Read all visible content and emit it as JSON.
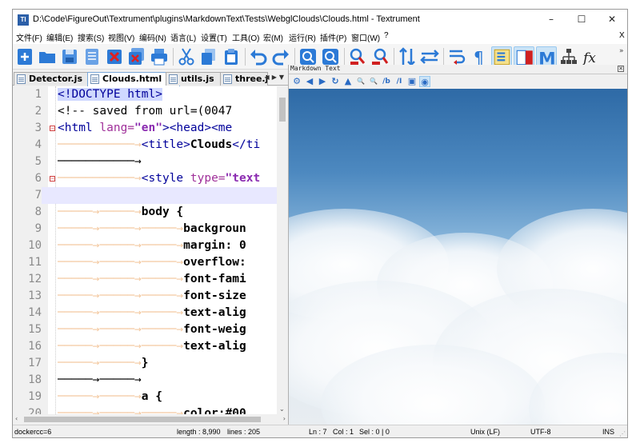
{
  "window": {
    "title": "D:\\Code\\FigureOut\\Textrument\\plugins\\MarkdownText\\Tests\\WebglClouds\\Clouds.html - Textrument",
    "app_icon_text": "TI",
    "controls": {
      "minimize": "–",
      "maximize": "☐",
      "close": "✕"
    }
  },
  "menu": {
    "items": [
      "文件(F)",
      "编辑(E)",
      "搜索(S)",
      "视图(V)",
      "编码(N)",
      "语言(L)",
      "设置(T)",
      "工具(O)",
      "宏(M)",
      "运行(R)",
      "插件(P)",
      "窗口(W)",
      "?"
    ],
    "close_label": "X"
  },
  "toolbar": {
    "buttons": [
      {
        "name": "new-file",
        "icon": "new-file-icon"
      },
      {
        "name": "open-folder",
        "icon": "folder-icon"
      },
      {
        "name": "save",
        "icon": "save-icon"
      },
      {
        "name": "save-all",
        "icon": "save-all-icon"
      },
      {
        "name": "close",
        "icon": "close-file-icon"
      },
      {
        "name": "close-all",
        "icon": "close-all-icon"
      },
      {
        "name": "print",
        "icon": "print-icon"
      },
      {
        "name": "cut",
        "icon": "cut-icon"
      },
      {
        "name": "copy",
        "icon": "copy-icon"
      },
      {
        "name": "paste",
        "icon": "paste-icon"
      },
      {
        "name": "undo",
        "icon": "undo-icon"
      },
      {
        "name": "redo",
        "icon": "redo-icon"
      },
      {
        "name": "zoom-in",
        "icon": "zoom-in-icon"
      },
      {
        "name": "zoom-out",
        "icon": "zoom-out-icon"
      },
      {
        "name": "find",
        "icon": "find-icon"
      },
      {
        "name": "replace",
        "icon": "replace-icon"
      },
      {
        "name": "sync-vertical",
        "icon": "sync-vertical-icon"
      },
      {
        "name": "sync-horizontal",
        "icon": "sync-horizontal-icon"
      },
      {
        "name": "word-wrap",
        "icon": "word-wrap-icon"
      },
      {
        "name": "show-all-chars",
        "icon": "pilcrow-icon"
      },
      {
        "name": "indent-guide",
        "icon": "indent-guide-icon"
      },
      {
        "name": "document-map",
        "icon": "document-map-icon"
      },
      {
        "name": "markdown-text",
        "icon": "markdown-icon"
      },
      {
        "name": "function-list",
        "icon": "function-list-icon"
      },
      {
        "name": "fx",
        "icon": "fx-icon"
      }
    ],
    "overflow_label": "»"
  },
  "tabs": [
    {
      "label": "Detector.js",
      "active": false
    },
    {
      "label": "Clouds.html",
      "active": true
    },
    {
      "label": "utils.js",
      "active": false
    },
    {
      "label": "three.js",
      "active": false
    }
  ],
  "tab_nav": {
    "prev": "◀",
    "next": "▶",
    "close": "▼"
  },
  "editor": {
    "current_line": 7,
    "lines": [
      {
        "n": "1"
      },
      {
        "n": "2"
      },
      {
        "n": "3"
      },
      {
        "n": "4"
      },
      {
        "n": "5"
      },
      {
        "n": "6"
      },
      {
        "n": "7"
      },
      {
        "n": "8"
      },
      {
        "n": "9"
      },
      {
        "n": "10"
      },
      {
        "n": "11"
      },
      {
        "n": "12"
      },
      {
        "n": "13"
      },
      {
        "n": "14"
      },
      {
        "n": "15"
      },
      {
        "n": "16"
      },
      {
        "n": "17"
      },
      {
        "n": "18"
      },
      {
        "n": "19"
      },
      {
        "n": "20"
      }
    ],
    "code": {
      "l1": "<!DOCTYPE html>",
      "l2": "<!-- saved from url=(0047",
      "l3a": "<html ",
      "l3b": "lang=",
      "l3c": "\"en\"",
      "l3d": "><head><me",
      "l4a": "<title>",
      "l4b": "Clouds",
      "l4c": "</ti",
      "l6a": "<style ",
      "l6b": "type=",
      "l6c": "\"text",
      "l8": "body {",
      "l9": "backgroun",
      "l10": "margin: 0",
      "l11": "overflow:",
      "l12": "font-fami",
      "l13": "font-size",
      "l14": "text-alig",
      "l15": "font-weig",
      "l16": "text-alig",
      "l17": "}",
      "l19": "a {",
      "l20": "color:#00"
    }
  },
  "markdown_panel": {
    "title": "Markdown Text",
    "close": "✕",
    "tools": [
      "⚙",
      "◀",
      "▶",
      "↻",
      "▲",
      "🔍+",
      "🔍−",
      "/b",
      "/I",
      "▣",
      "◉"
    ],
    "colors": {
      "sky_top": "#2e6aa6",
      "sky_mid": "#86b4da",
      "cloud": "#ffffff"
    }
  },
  "status": {
    "left": "dockercc=6",
    "length": "length : 8,990",
    "lines": "lines : 205",
    "position": "Ln : 7",
    "column": "Col : 1",
    "selection": "Sel : 0 | 0",
    "eol": "Unix (LF)",
    "encoding": "UTF-8",
    "mode": "INS"
  }
}
